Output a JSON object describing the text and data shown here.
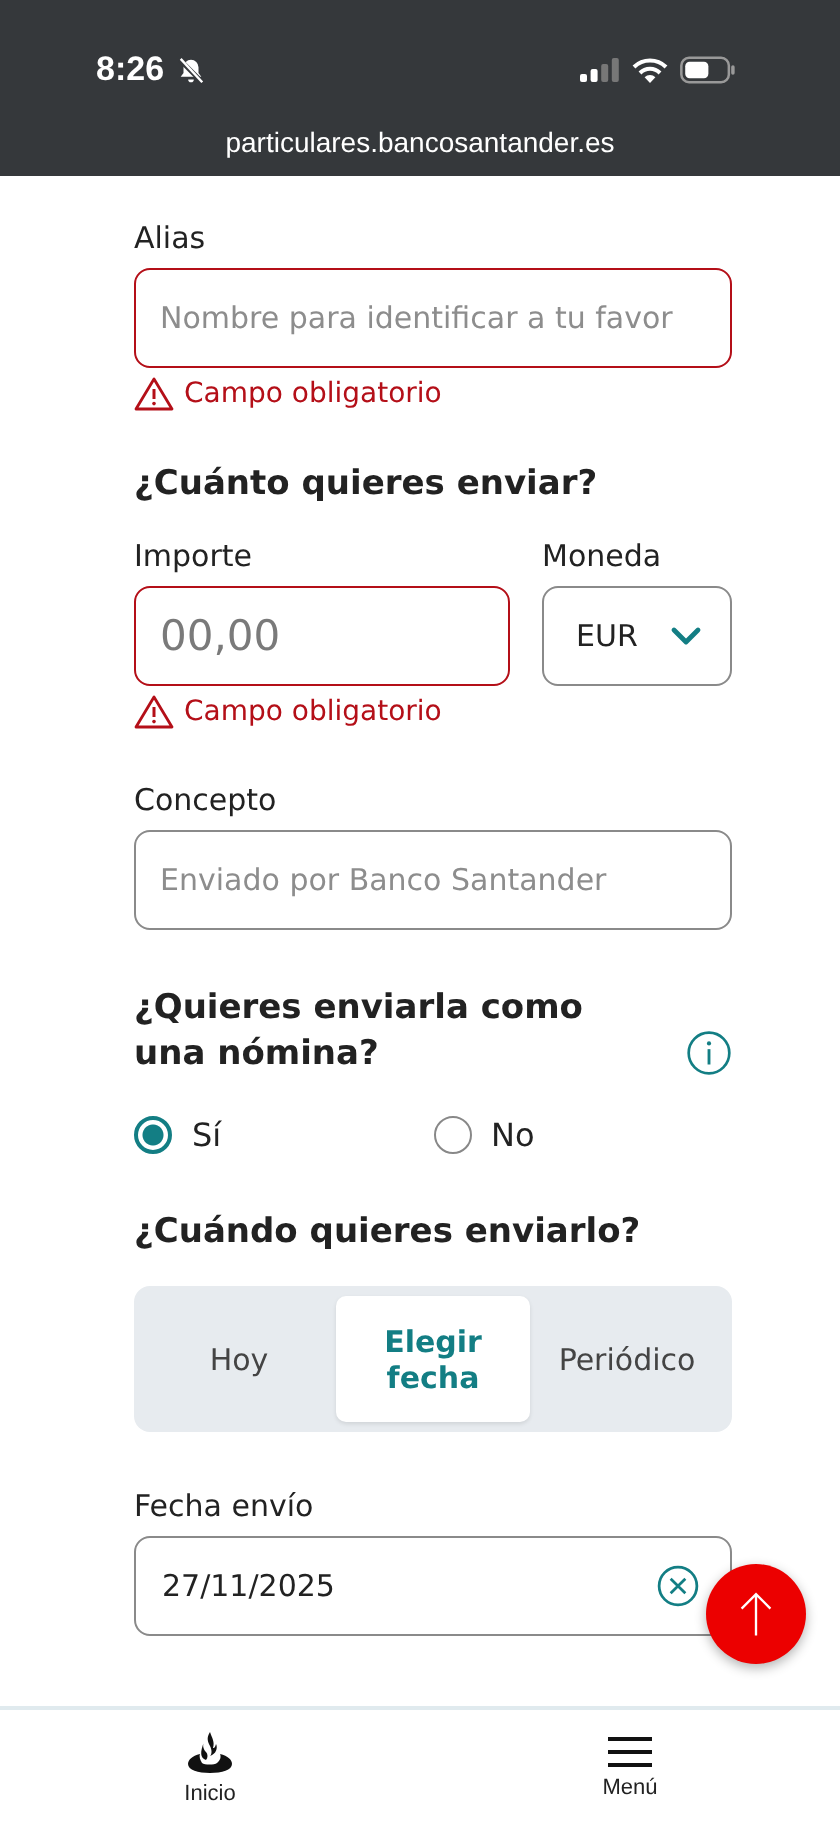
{
  "status_bar": {
    "time": "8:26",
    "url": "particulares.bancosantander.es"
  },
  "alias": {
    "label": "Alias",
    "placeholder": "Nombre para identificar a tu favor",
    "error": "Campo obligatorio"
  },
  "amount_heading": "¿Cuánto quieres enviar?",
  "amount": {
    "label": "Importe",
    "placeholder": "00,00",
    "error": "Campo obligatorio"
  },
  "currency": {
    "label": "Moneda",
    "value": "EUR"
  },
  "concept": {
    "label": "Concepto",
    "placeholder": "Enviado por Banco Santander"
  },
  "payroll_heading": "¿Quieres enviarla como una nómina?",
  "payroll_options": [
    {
      "label": "Sí",
      "selected": true
    },
    {
      "label": "No",
      "selected": false
    }
  ],
  "when_heading": "¿Cuándo quieres enviarlo?",
  "when_tabs": [
    {
      "label": "Hoy",
      "selected": false
    },
    {
      "label": "Elegir fecha",
      "selected": true
    },
    {
      "label": "Periódico",
      "selected": false
    }
  ],
  "date": {
    "label": "Fecha envío",
    "value": "27/11/2025"
  },
  "bottom_nav": [
    {
      "label": "Inicio",
      "kind": "home"
    },
    {
      "label": "Menú",
      "kind": "menu"
    }
  ]
}
